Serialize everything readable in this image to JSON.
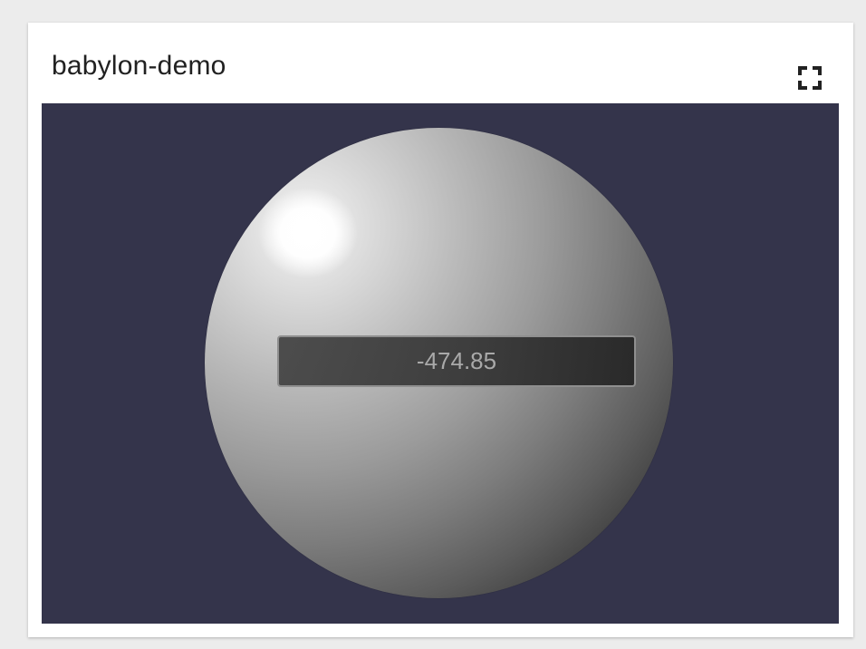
{
  "widget": {
    "title": "babylon-demo",
    "fullscreen_icon": "fullscreen-icon"
  },
  "scene": {
    "background_color": "#34344b",
    "value_label": "-474.85"
  }
}
